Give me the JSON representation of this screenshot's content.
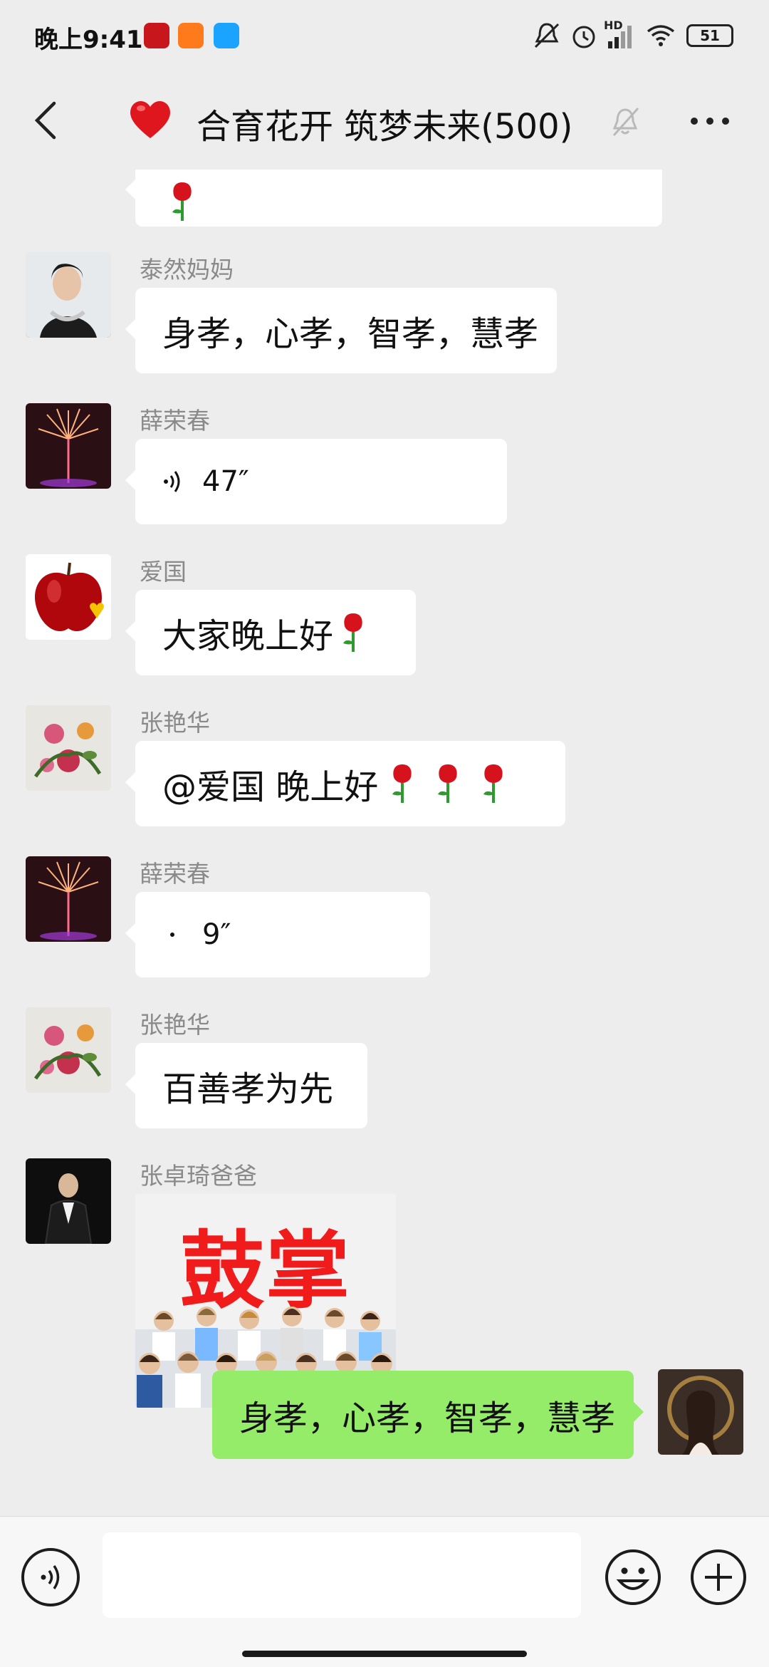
{
  "status_bar": {
    "time": "晚上9:41",
    "battery": "51",
    "network": "HD"
  },
  "header": {
    "title": "合育花开 筑梦未来(500)",
    "back_icon": "chevron-left-icon",
    "more_icon": "more-dots-icon",
    "mute_icon": "bell-muted-icon"
  },
  "messages": [
    {
      "sender": "泰然妈妈",
      "text": "身孝，心孝，智孝，慧孝"
    },
    {
      "sender": "薛荣春",
      "duration": "47″"
    },
    {
      "sender": "爱国",
      "text": "大家晚上好"
    },
    {
      "sender": "张艳华",
      "text": "@爱国  晚上好"
    },
    {
      "sender": "薛荣春",
      "duration": "9″"
    },
    {
      "sender": "张艳华",
      "text": "百善孝为先"
    },
    {
      "sender": "张卓琦爸爸",
      "sticker_text": "鼓掌"
    }
  ],
  "my_message": {
    "text": "身孝，心孝，智孝，慧孝"
  },
  "input": {
    "placeholder": "",
    "value": ""
  },
  "colors": {
    "background": "#ededed",
    "bubble_self": "#95ec69",
    "bubble_other": "#ffffff",
    "sticker_red": "#f01b1b"
  }
}
